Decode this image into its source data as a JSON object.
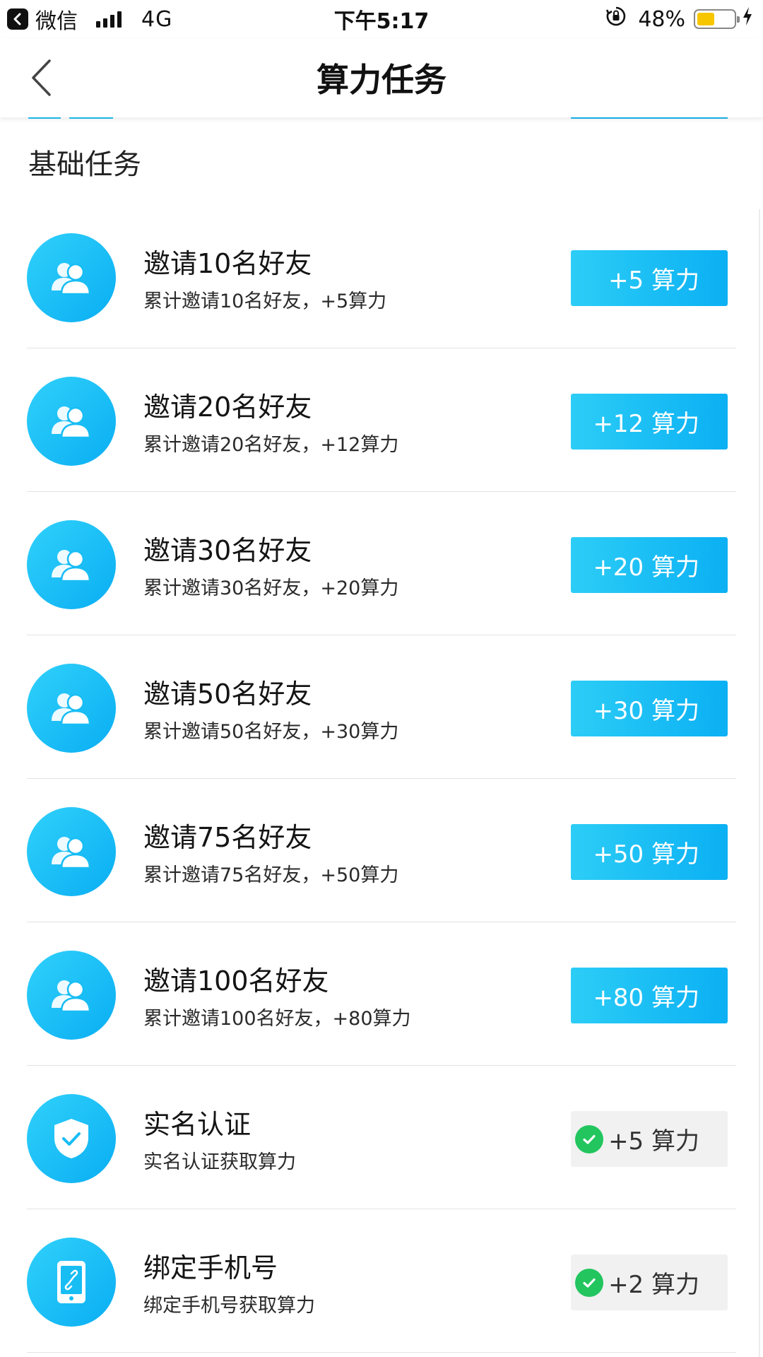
{
  "status_bar": {
    "app_name": "微信",
    "network": "4G",
    "time": "下午5:17",
    "battery_percent": "48%",
    "battery_level": 0.48,
    "battery_color": "#f7c600"
  },
  "nav": {
    "title": "算力任务",
    "back_icon": "chevron-left-icon"
  },
  "section": {
    "title": "基础任务"
  },
  "tasks": [
    {
      "icon": "users-icon",
      "title": "邀请10名好友",
      "desc": "累计邀请10名好友，+5算力",
      "reward": "+5 算力",
      "completed": false
    },
    {
      "icon": "users-icon",
      "title": "邀请20名好友",
      "desc": "累计邀请20名好友，+12算力",
      "reward": "+12 算力",
      "completed": false
    },
    {
      "icon": "users-icon",
      "title": "邀请30名好友",
      "desc": "累计邀请30名好友，+20算力",
      "reward": "+20 算力",
      "completed": false
    },
    {
      "icon": "users-icon",
      "title": "邀请50名好友",
      "desc": "累计邀请50名好友，+30算力",
      "reward": "+30 算力",
      "completed": false
    },
    {
      "icon": "users-icon",
      "title": "邀请75名好友",
      "desc": "累计邀请75名好友，+50算力",
      "reward": "+50 算力",
      "completed": false
    },
    {
      "icon": "users-icon",
      "title": "邀请100名好友",
      "desc": "累计邀请100名好友，+80算力",
      "reward": "+80 算力",
      "completed": false
    },
    {
      "icon": "shield-check-icon",
      "title": "实名认证",
      "desc": "实名认证获取算力",
      "reward": "+5 算力",
      "completed": true
    },
    {
      "icon": "phone-link-icon",
      "title": "绑定手机号",
      "desc": "绑定手机号获取算力",
      "reward": "+2 算力",
      "completed": true
    }
  ],
  "colors": {
    "accent": "#0bb0f3",
    "accent_light": "#2ccdf6",
    "done_bg": "#f1f1f1",
    "check": "#22c55e"
  }
}
